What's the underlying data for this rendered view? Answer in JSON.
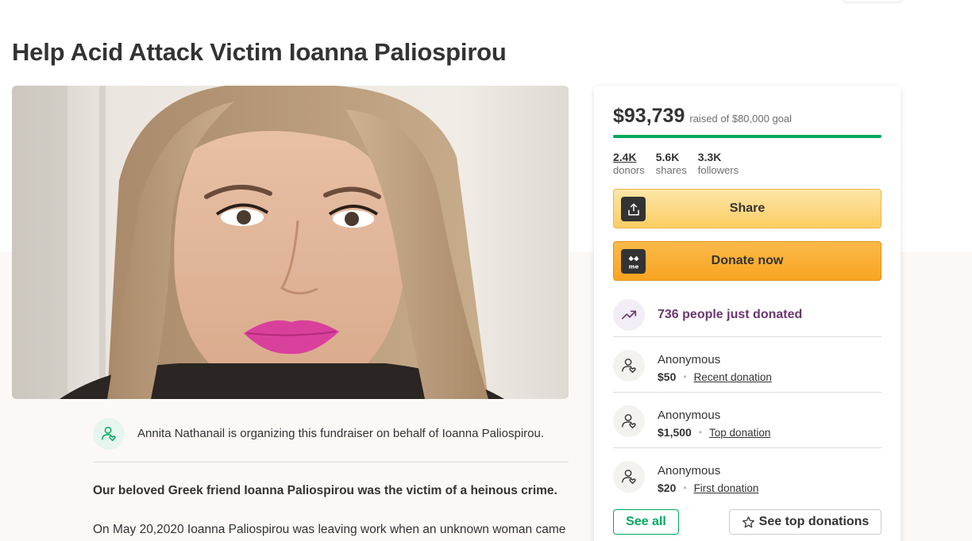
{
  "page": {
    "title": "Help Acid Attack Victim Ioanna Paliospirou"
  },
  "hero": {
    "alt": "Photo of Ioanna Paliospirou"
  },
  "organizer": {
    "icon": "person-heart-icon",
    "text": "Annita Nathanail is organizing this fundraiser on behalf of Ioanna Paliospirou."
  },
  "story": {
    "headline": "Our beloved Greek friend Ioanna Paliospirou was the victim of a heinous crime.",
    "paragraph": "On May 20,2020 Ioanna Paliospirou was leaving work when an unknown woman came"
  },
  "donation_card": {
    "raised": "$93,739",
    "goal_text": "raised of $80,000 goal",
    "progress_fraction": 1.0,
    "stats": [
      {
        "value": "2.4K",
        "label": "donors"
      },
      {
        "value": "5.6K",
        "label": "shares"
      },
      {
        "value": "3.3K",
        "label": "followers"
      }
    ],
    "share_label": "Share",
    "donate_label": "Donate now",
    "trend_text": "736 people just donated",
    "donations": [
      {
        "name": "Anonymous",
        "amount": "$50",
        "type": "Recent donation"
      },
      {
        "name": "Anonymous",
        "amount": "$1,500",
        "type": "Top donation"
      },
      {
        "name": "Anonymous",
        "amount": "$20",
        "type": "First donation"
      }
    ],
    "see_all_label": "See all",
    "see_top_label": "See top donations"
  },
  "colors": {
    "accent_green": "#02a95c",
    "trend_purple": "#6b366f",
    "donate_orange": "#f8a421",
    "share_yellow": "#fbcd63"
  }
}
